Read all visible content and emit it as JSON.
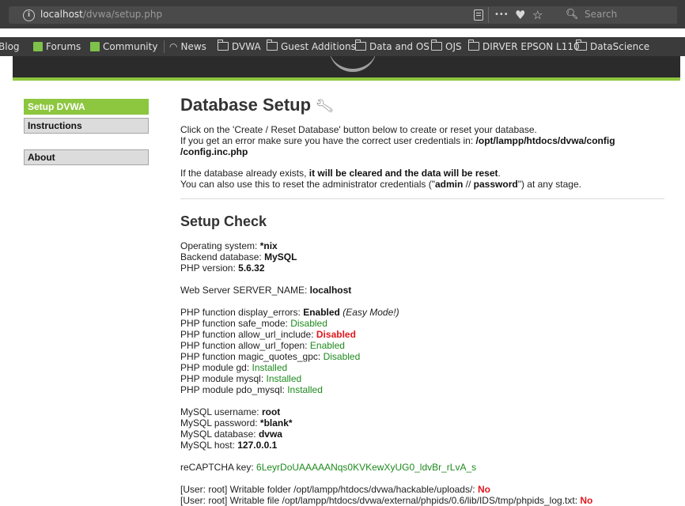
{
  "browser": {
    "url_host": "localhost",
    "url_path": "/dvwa/setup.php",
    "search_placeholder": "Search",
    "more_glyph": "•••",
    "pocket_glyph": "♥",
    "star_glyph": "☆",
    "search_glyph": "🔍︎",
    "bookmarks": [
      "Blog",
      "Forums",
      "Community",
      "News",
      "DVWA",
      "Guest Additions",
      "Data and OS",
      "OJS",
      "DIRVER EPSON L110",
      "DataScience"
    ]
  },
  "menu": {
    "setup": "Setup DVWA",
    "instructions": "Instructions",
    "about": "About"
  },
  "page": {
    "title": "Database Setup",
    "intro1": "Click on the 'Create / Reset Database' button below to create or reset your database.",
    "intro2_pre": "If you get an error make sure you have the correct user credentials in: ",
    "intro2_path": "/opt/lampp/htdocs/dvwa/config",
    "intro3_path": "/config.inc.php",
    "exists1_pre": "If the database already exists, ",
    "exists1_bold": "it will be cleared and the data will be reset",
    "exists1_post": ".",
    "exists2_pre": "You can also use this to reset the administrator credentials (\"",
    "admin": "admin",
    "slashes": " // ",
    "password": "password",
    "exists2_post": "\") at any stage."
  },
  "check": {
    "title": "Setup Check",
    "os_label": "Operating system: ",
    "os_value": "*nix",
    "db_label": "Backend database: ",
    "db_value": "MySQL",
    "php_label": "PHP version: ",
    "php_value": "5.6.32",
    "server_label": "Web Server SERVER_NAME: ",
    "server_value": "localhost",
    "display_errors_label": "PHP function display_errors: ",
    "display_errors_value": "Enabled",
    "display_errors_note": "(Easy Mode!)",
    "safe_mode_label": "PHP function safe_mode: ",
    "safe_mode_value": "Disabled",
    "allow_url_include_label": "PHP function allow_url_include: ",
    "allow_url_include_value": "Disabled",
    "allow_url_fopen_label": "PHP function allow_url_fopen: ",
    "allow_url_fopen_value": "Enabled",
    "magic_quotes_label": "PHP function magic_quotes_gpc: ",
    "magic_quotes_value": "Disabled",
    "gd_label": "PHP module gd: ",
    "gd_value": "Installed",
    "mysql_label": "PHP module mysql: ",
    "mysql_value": "Installed",
    "pdo_label": "PHP module pdo_mysql: ",
    "pdo_value": "Installed",
    "user_label": "MySQL username: ",
    "user_value": "root",
    "pass_label": "MySQL password: ",
    "pass_value": "*blank*",
    "database_label": "MySQL database: ",
    "database_value": "dvwa",
    "host_label": "MySQL host: ",
    "host_value": "127.0.0.1",
    "recaptcha_label": "reCAPTCHA key: ",
    "recaptcha_value": "6LeyrDoUAAAAANqs0KVKewXyUG0_ldvBr_rLvA_s",
    "uploads_label": "[User: root] Writable folder /opt/lampp/htdocs/dvwa/hackable/uploads/: ",
    "uploads_value": "No",
    "phpids_label": "[User: root] Writable file /opt/lampp/htdocs/dvwa/external/phpids/0.6/lib/IDS/tmp/phpids_log.txt: ",
    "phpids_value": "No"
  },
  "colors": {
    "accent_green": "#8dc63f",
    "ok_green": "#1e8a1e",
    "error_red": "#e0181e"
  }
}
